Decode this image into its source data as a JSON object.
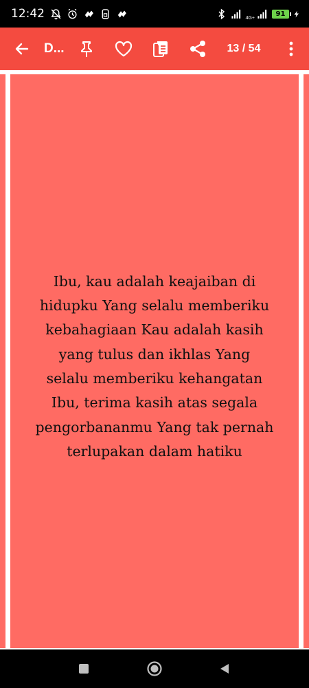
{
  "status_bar": {
    "time": "12:42",
    "network_label": "4G+",
    "battery_level": "91"
  },
  "app_bar": {
    "title": "D...",
    "page_counter": "13 / 54",
    "background_color": "#f44b40",
    "icons": [
      "back-arrow-icon",
      "pin-icon",
      "heart-icon",
      "copy-icon",
      "share-icon",
      "more-vert-icon"
    ]
  },
  "card": {
    "background_color": "#ff6b63",
    "quote": "Ibu, kau adalah keajaiban di\nhidupku Yang selalu memberiku\nkebahagiaan Kau adalah kasih\nyang tulus dan ikhlas Yang\nselalu memberiku kehangatan\nIbu, terima kasih atas segala\npengorbananmu Yang tak pernah\nterlupakan dalam hatiku"
  },
  "nav_bar": {
    "icons": [
      "recent-apps-icon",
      "home-icon",
      "back-icon"
    ]
  }
}
